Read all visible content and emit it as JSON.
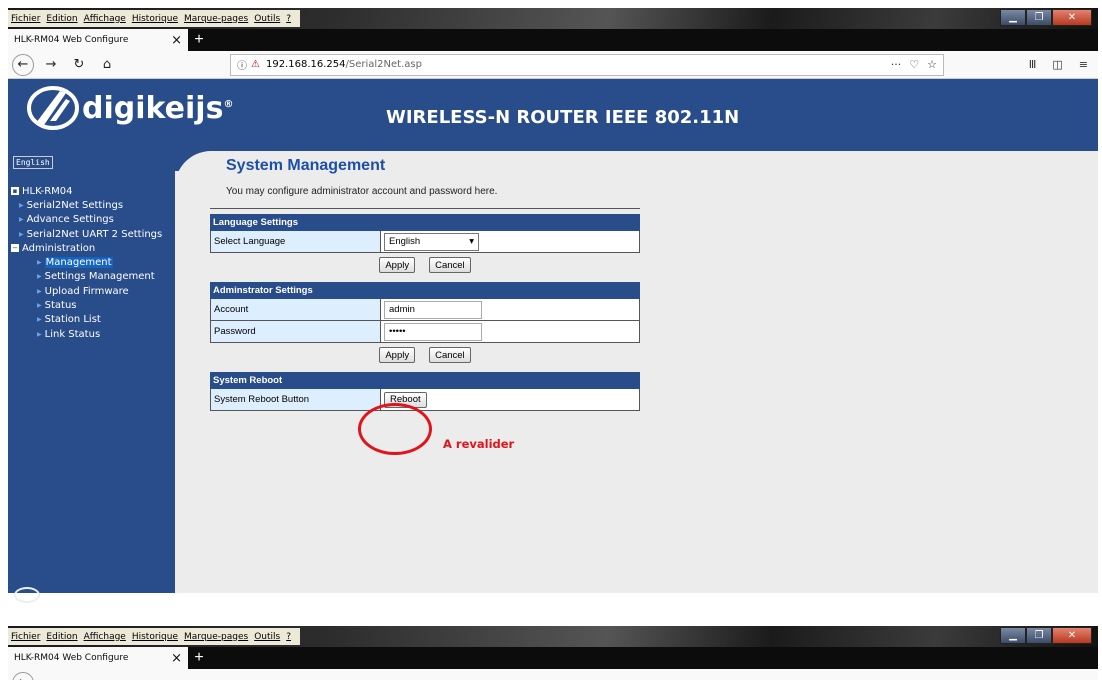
{
  "menubar": [
    "Fichier",
    "Edition",
    "Affichage",
    "Historique",
    "Marque-pages",
    "Outils",
    "?"
  ],
  "tab": {
    "title": "HLK-RM04 Web Configure",
    "close": "×",
    "new": "+"
  },
  "url": {
    "host": "192.168.16.254",
    "path": "/Serial2Net.asp"
  },
  "banner": {
    "brand": "digikeijs",
    "reg": "®",
    "title": "WIRELESS-N ROUTER IEEE 802.11N"
  },
  "sidebar": {
    "language": "English",
    "root": "HLK-RM04",
    "items": [
      "Serial2Net Settings",
      "Advance Settings",
      "Serial2Net UART 2 Settings"
    ],
    "admin": "Administration",
    "admin_items": [
      "Management",
      "Settings Management",
      "Upload Firmware",
      "Status",
      "Station List",
      "Link Status"
    ],
    "selected": "Management"
  },
  "page": {
    "title": "System Management",
    "desc": "You may configure administrator account and password here.",
    "lang_section": "Language Settings",
    "lang_label": "Select Language",
    "lang_value": "English",
    "admin_section": "Adminstrator Settings",
    "account_label": "Account",
    "account_value": "admin",
    "password_label": "Password",
    "password_value": "•••••",
    "reboot_section": "System Reboot",
    "reboot_label": "System Reboot Button",
    "reboot_btn": "Reboot",
    "apply": "Apply",
    "cancel": "Cancel"
  },
  "annotation": {
    "text": "A revalider",
    "color": "#e0141b"
  }
}
